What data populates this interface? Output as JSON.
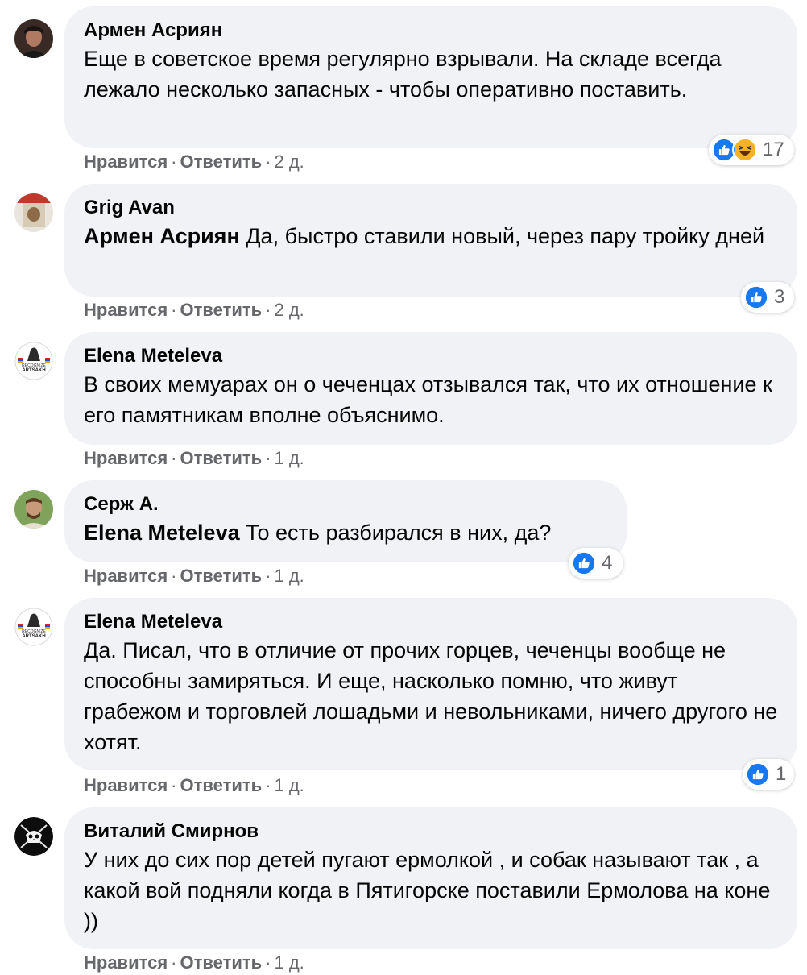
{
  "actions": {
    "like": "Нравится",
    "reply": "Ответить",
    "separator": "·"
  },
  "colors": {
    "bubble": "#f0f2f5",
    "meta_text": "#65676b",
    "like_blue": "#1877f2",
    "haha_yellow": "#f7b125"
  },
  "comments": [
    {
      "author": "Армен Асриян",
      "avatar_icon": "profile-photo-icon",
      "mention": "",
      "text": "Еще в советское время регулярно взрывали. На складе всегда лежало несколько запасных - чтобы оперативно поставить.",
      "time": "2 д.",
      "reactions": [
        "like-icon",
        "haha-icon"
      ],
      "reaction_count": "17"
    },
    {
      "author": "Grig Avan",
      "avatar_icon": "profile-photo-icon",
      "mention": "Армен Асриян",
      "text": "Да, быстро ставили новый, через пару тройку дней",
      "time": "2 д.",
      "reactions": [
        "like-icon"
      ],
      "reaction_count": "3"
    },
    {
      "author": "Elena Meteleva",
      "avatar_icon": "recognize-artsakh-logo-icon",
      "avatar_caption_top": "RECOGNIZE",
      "avatar_caption_bottom": "ARTSAKH",
      "mention": "",
      "text": "В своих мемуарах он о чеченцах отзывался так, что их отношение к его памятникам вполне объяснимо.",
      "time": "1 д."
    },
    {
      "author": "Серж А.",
      "avatar_icon": "profile-photo-icon",
      "mention": "Elena Meteleva",
      "text": "То есть разбирался в них, да?",
      "time": "1 д.",
      "reactions": [
        "like-icon"
      ],
      "reaction_count": "4"
    },
    {
      "author": "Elena Meteleva",
      "avatar_icon": "recognize-artsakh-logo-icon",
      "avatar_caption_top": "RECOGNIZE",
      "avatar_caption_bottom": "ARTSAKH",
      "mention": "",
      "text": "Да. Писал, что в отличие от прочих горцев, чеченцы вообще не способны замиряться. И еще, насколько помню, что живут грабежом и торговлей лошадьми и невольниками, ничего другого не хотят.",
      "time": "1 д.",
      "reactions": [
        "like-icon"
      ],
      "reaction_count": "1"
    },
    {
      "author": "Виталий Смирнов",
      "avatar_icon": "skull-emblem-icon",
      "mention": "",
      "text": "У них до сих пор детей пугают ермолкой , и собак называют так , а какой вой подняли когда в Пятигорске поставили Ермолова на коне ))",
      "time": "1 д."
    }
  ]
}
